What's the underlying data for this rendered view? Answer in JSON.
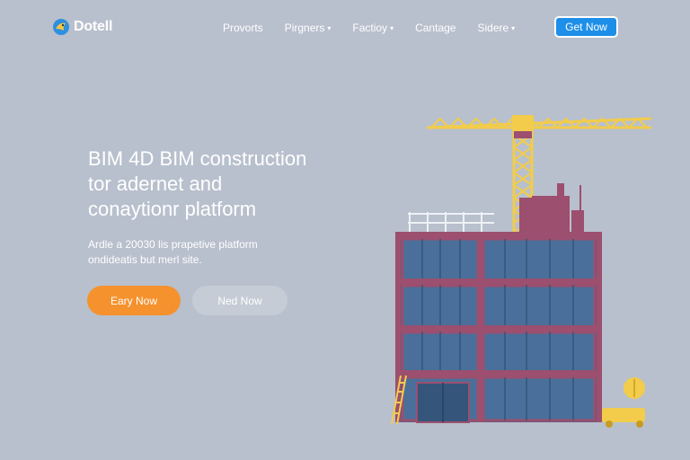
{
  "brand": {
    "name": "Dotell",
    "logo_icon": "bird-logo-icon"
  },
  "nav": {
    "items": [
      {
        "label": "Provorts",
        "has_dropdown": false
      },
      {
        "label": "Pirgners",
        "has_dropdown": true
      },
      {
        "label": "Factioy",
        "has_dropdown": true
      },
      {
        "label": "Cantage",
        "has_dropdown": false
      },
      {
        "label": "Sidere",
        "has_dropdown": true
      }
    ],
    "caret": "▾",
    "cta_label": "Get Now"
  },
  "hero": {
    "title_lines": [
      "BIM 4D BIM construction",
      "tor adernet and",
      "conaytionr platform"
    ],
    "subtitle_lines": [
      "Ardle a 20030 lis prapetive platform",
      "ondideatis but merl site."
    ],
    "primary_button": "Eary Now",
    "secondary_button": "Ned Now"
  },
  "colors": {
    "background": "#b8c0cd",
    "accent_blue": "#1e8fe8",
    "accent_orange": "#f5922e",
    "building_frame": "#9c4f6e",
    "glass": "#4a6f9a",
    "crane_yellow": "#f2cc4a"
  }
}
